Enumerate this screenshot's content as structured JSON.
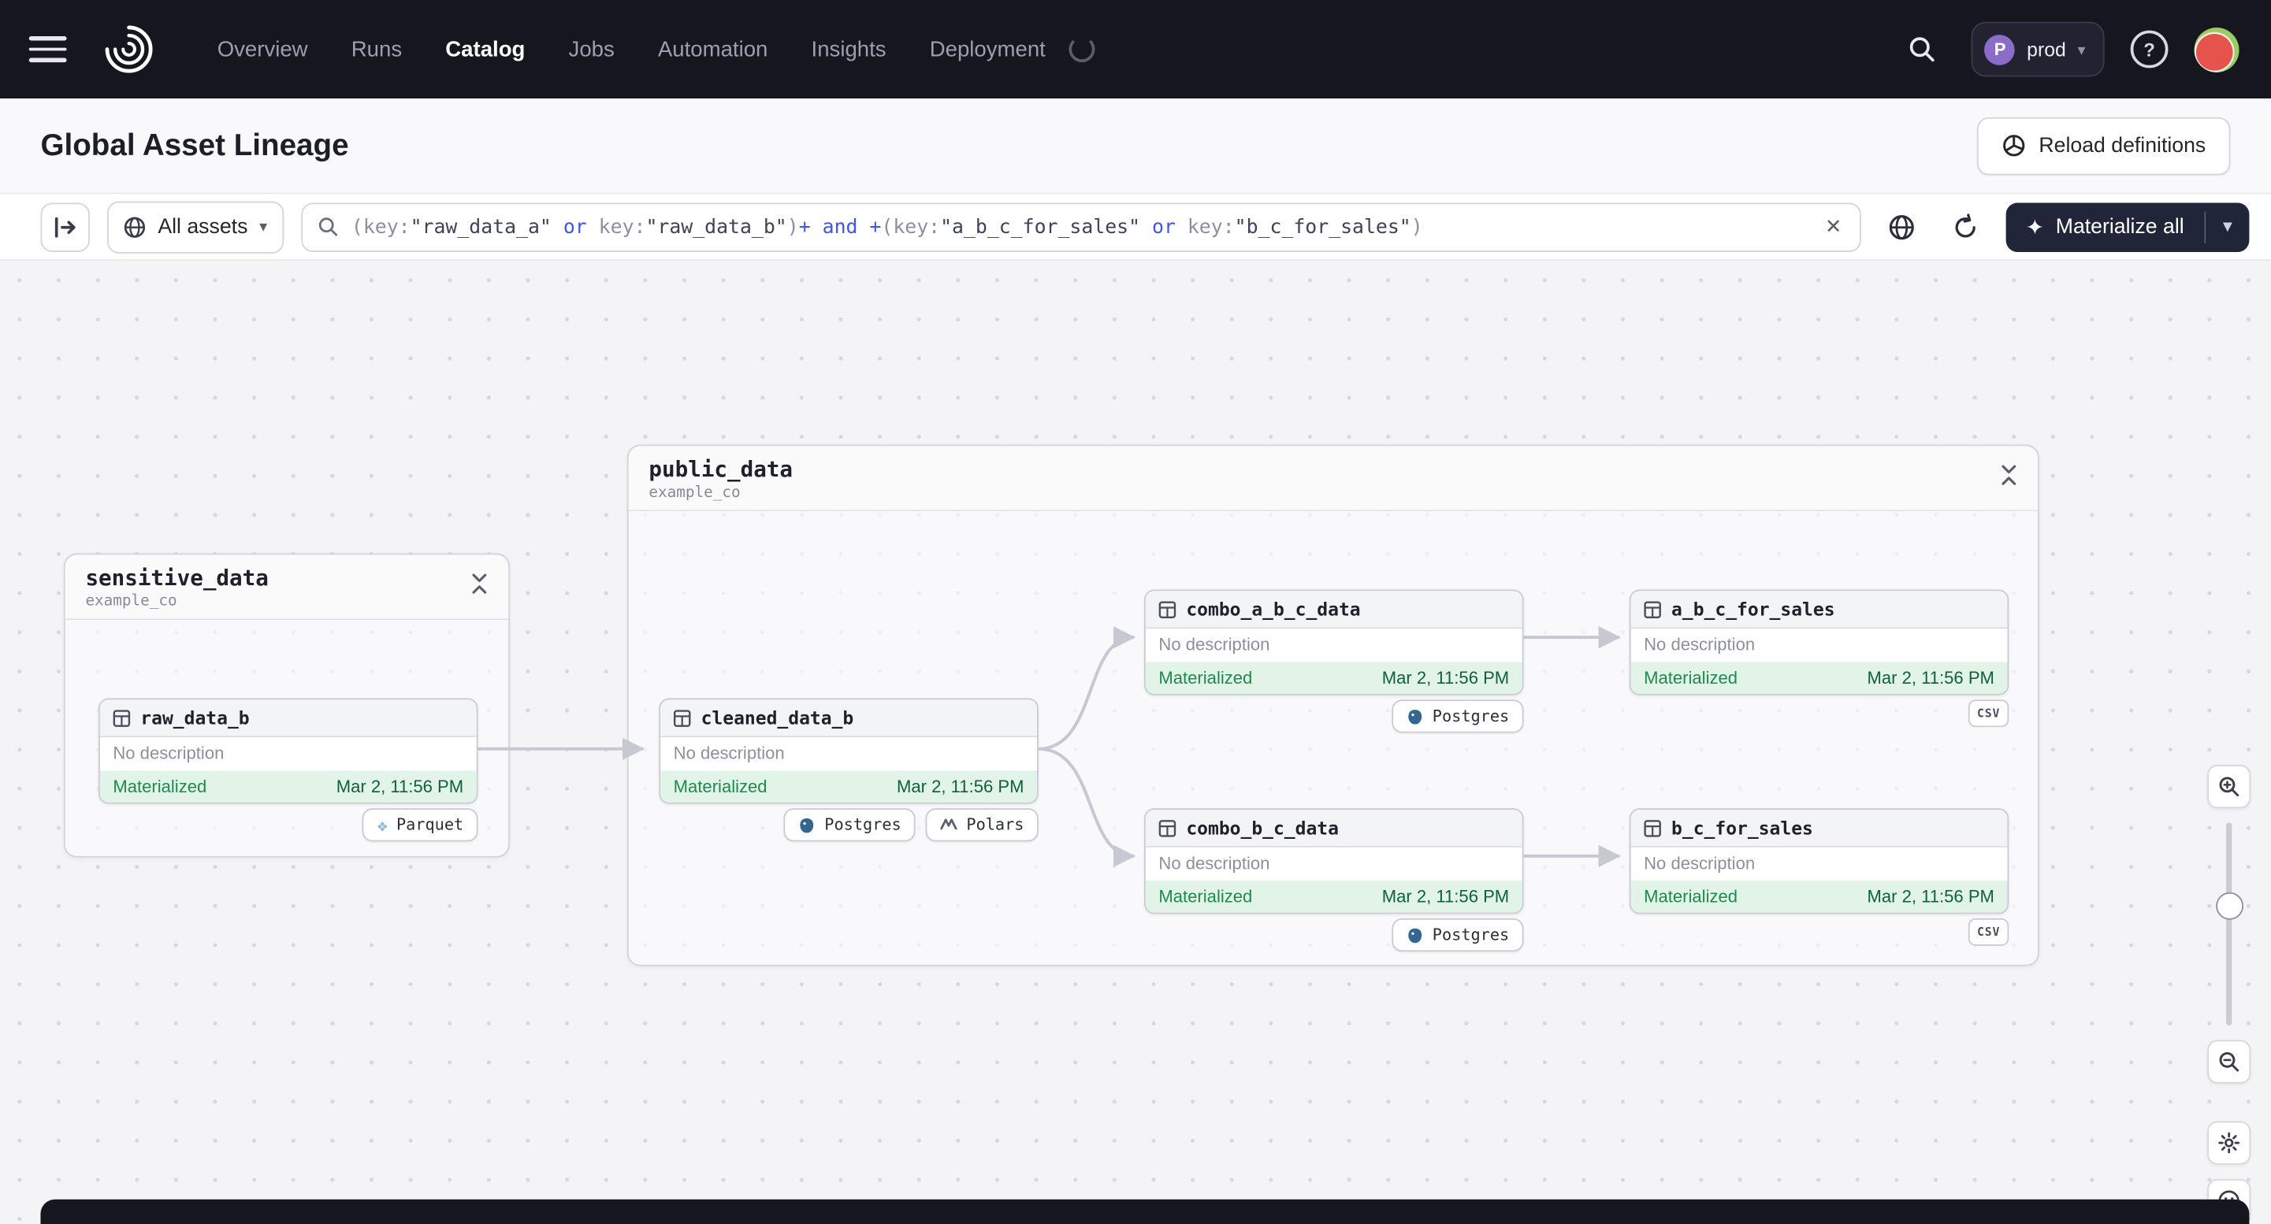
{
  "nav": {
    "items": [
      "Overview",
      "Runs",
      "Catalog",
      "Jobs",
      "Automation",
      "Insights",
      "Deployment"
    ],
    "active_item": "Catalog",
    "deployment_badge": {
      "initial": "P",
      "name": "prod"
    }
  },
  "header": {
    "title": "Global Asset Lineage",
    "reload_button_label": "Reload definitions"
  },
  "toolbar": {
    "scope_selector_label": "All assets",
    "materialize_button_label": "Materialize all",
    "query_string": "(key:\"raw_data_a\" or key:\"raw_data_b\")+ and +(key:\"a_b_c_for_sales\" or key:\"b_c_for_sales\")",
    "query_tokens": [
      {
        "t": "(key:",
        "c": "punct"
      },
      {
        "t": "\"raw_data_a\"",
        "c": "str"
      },
      {
        "t": " ",
        "c": "punct"
      },
      {
        "t": "or",
        "c": "op"
      },
      {
        "t": " ",
        "c": "punct"
      },
      {
        "t": "key:",
        "c": "punct"
      },
      {
        "t": "\"raw_data_b\"",
        "c": "str"
      },
      {
        "t": ")",
        "c": "punct"
      },
      {
        "t": "+",
        "c": "op"
      },
      {
        "t": " ",
        "c": "punct"
      },
      {
        "t": "and",
        "c": "op"
      },
      {
        "t": " ",
        "c": "punct"
      },
      {
        "t": "+",
        "c": "op"
      },
      {
        "t": "(key:",
        "c": "punct"
      },
      {
        "t": "\"a_b_c_for_sales\"",
        "c": "str"
      },
      {
        "t": " ",
        "c": "punct"
      },
      {
        "t": "or",
        "c": "op"
      },
      {
        "t": " ",
        "c": "punct"
      },
      {
        "t": "key:",
        "c": "punct"
      },
      {
        "t": "\"b_c_for_sales\"",
        "c": "str"
      },
      {
        "t": ")",
        "c": "punct"
      }
    ]
  },
  "graph": {
    "groups": {
      "sensitive_data": {
        "name": "sensitive_data",
        "namespace": "example_co"
      },
      "public_data": {
        "name": "public_data",
        "namespace": "example_co"
      }
    },
    "nodes": {
      "raw_data_b": {
        "name": "raw_data_b",
        "description": "No description",
        "status": "Materialized",
        "timestamp": "Mar 2, 11:56 PM",
        "tags": [
          "Parquet"
        ]
      },
      "cleaned_data_b": {
        "name": "cleaned_data_b",
        "description": "No description",
        "status": "Materialized",
        "timestamp": "Mar 2, 11:56 PM",
        "tags": [
          "Postgres",
          "Polars"
        ]
      },
      "combo_a_b_c_data": {
        "name": "combo_a_b_c_data",
        "description": "No description",
        "status": "Materialized",
        "timestamp": "Mar 2, 11:56 PM",
        "tags": [
          "Postgres"
        ]
      },
      "a_b_c_for_sales": {
        "name": "a_b_c_for_sales",
        "description": "No description",
        "status": "Materialized",
        "timestamp": "Mar 2, 11:56 PM",
        "tags": [
          "CSV"
        ]
      },
      "combo_b_c_data": {
        "name": "combo_b_c_data",
        "description": "No description",
        "status": "Materialized",
        "timestamp": "Mar 2, 11:56 PM",
        "tags": [
          "Postgres"
        ]
      },
      "b_c_for_sales": {
        "name": "b_c_for_sales",
        "description": "No description",
        "status": "Materialized",
        "timestamp": "Mar 2, 11:56 PM",
        "tags": [
          "CSV"
        ]
      }
    }
  },
  "colors": {
    "nav_bg": "#16161f",
    "status_green_bg": "#e2f4e8",
    "status_green_text": "#1e8a4e",
    "operator_blue": "#3f56e8",
    "edge_gray": "#c6c9d2",
    "materialize_bg": "#212539"
  }
}
